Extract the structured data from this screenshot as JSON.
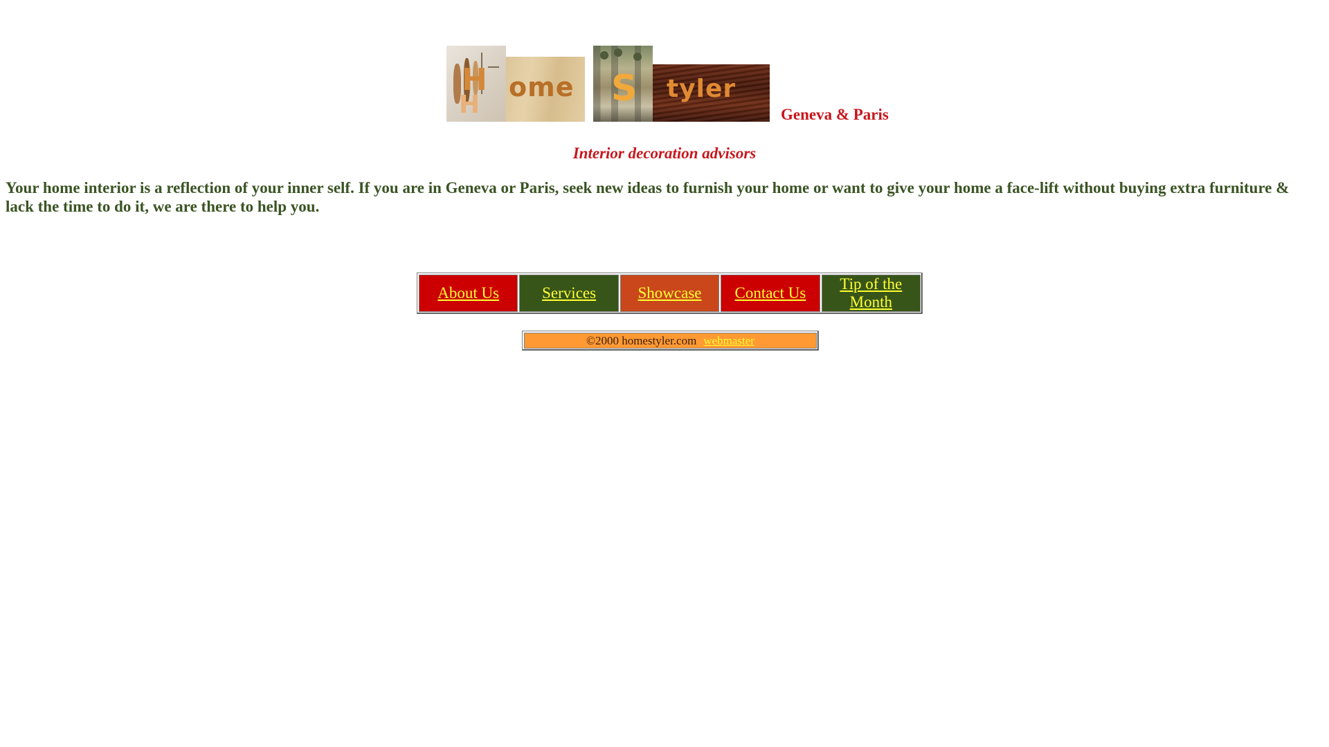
{
  "logo": {
    "letters": [
      "H",
      "H",
      "ome",
      "S",
      "tyler"
    ],
    "location": "Geneva & Paris"
  },
  "tagline": "Interior decoration advisors",
  "intro": "Your home interior is a reflection of your inner self. If you are in Geneva or Paris, seek new ideas to furnish your home or want to give your home a face-lift without buying extra furniture & lack the time to do it, we are there to help you.",
  "nav": {
    "items": [
      {
        "label": "About Us",
        "color": "#cc0000"
      },
      {
        "label": "Services",
        "color": "#385519"
      },
      {
        "label": "Showcase",
        "color": "#c9471b"
      },
      {
        "label": "Contact Us",
        "color": "#cc0000"
      },
      {
        "label": "Tip of the Month",
        "color": "#385519"
      }
    ]
  },
  "footer": {
    "copyright": "©2000 homestyler.com",
    "webmaster_link": "webmaster",
    "background": "#ff9933"
  },
  "colors": {
    "heading_red": "#c8161c",
    "text_green": "#3a5423",
    "link_yellow": "#ffff33"
  }
}
